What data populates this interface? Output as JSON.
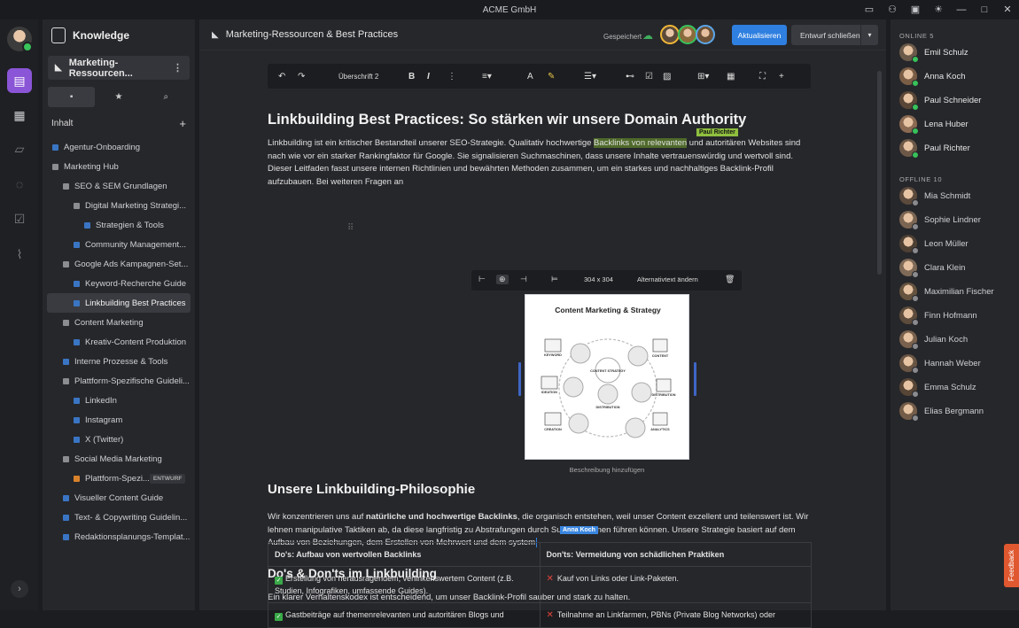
{
  "window": {
    "title": "ACME GmbH"
  },
  "sidebar": {
    "brand": "Knowledge",
    "current_page": "Marketing-Ressourcen...",
    "section_title": "Inhalt",
    "tree": [
      {
        "label": "Agentur-Onboarding",
        "level": 0,
        "color": "#3a75c4"
      },
      {
        "label": "Marketing Hub",
        "level": 0,
        "color": "#8c8d91"
      },
      {
        "label": "SEO & SEM Grundlagen",
        "level": 1,
        "color": "#8c8d91"
      },
      {
        "label": "Digital Marketing Strategi...",
        "level": 2,
        "color": "#8c8d91"
      },
      {
        "label": "Strategien & Tools",
        "level": 3,
        "color": "#3a75c4"
      },
      {
        "label": "Community Management...",
        "level": 2,
        "color": "#3a75c4"
      },
      {
        "label": "Google Ads Kampagnen-Set...",
        "level": 1,
        "color": "#8c8d91"
      },
      {
        "label": "Keyword-Recherche Guide",
        "level": 2,
        "color": "#3a75c4"
      },
      {
        "label": "Linkbuilding Best Practices",
        "level": 2,
        "color": "#3a75c4",
        "active": true
      },
      {
        "label": "Content Marketing",
        "level": 1,
        "color": "#8c8d91"
      },
      {
        "label": "Kreativ-Content Produktion",
        "level": 2,
        "color": "#3a75c4"
      },
      {
        "label": "Interne Prozesse & Tools",
        "level": 1,
        "color": "#3a75c4"
      },
      {
        "label": "Plattform-Spezifische Guideli...",
        "level": 1,
        "color": "#8c8d91"
      },
      {
        "label": "LinkedIn",
        "level": 2,
        "color": "#3a75c4"
      },
      {
        "label": "Instagram",
        "level": 2,
        "color": "#3a75c4"
      },
      {
        "label": "X (Twitter)",
        "level": 2,
        "color": "#3a75c4"
      },
      {
        "label": "Social Media Marketing",
        "level": 1,
        "color": "#8c8d91"
      },
      {
        "label": "Plattform-Spezi...",
        "level": 2,
        "color": "#d9822b",
        "badge": "ENTWURF"
      },
      {
        "label": "Visueller Content Guide",
        "level": 1,
        "color": "#3a75c4"
      },
      {
        "label": "Text- & Copywriting Guidelin...",
        "level": 1,
        "color": "#3a75c4"
      },
      {
        "label": "Redaktionsplanungs-Templat...",
        "level": 1,
        "color": "#3a75c4"
      }
    ]
  },
  "header": {
    "title": "Marketing-Ressourcen & Best Practices",
    "saved": "Gespeichert",
    "update_button": "Aktualisieren",
    "close_draft_button": "Entwurf schließen"
  },
  "toolbar": {
    "heading_style": "Überschrift 2"
  },
  "doc": {
    "h1": "Linkbuilding Best Practices: So stärken wir unsere Domain Authority",
    "p1_a": "Linkbuilding ist ein kritischer Bestandteil unserer SEO-Strategie. Qualitativ hochwertige ",
    "p1_hl": "Backlinks von relevanten",
    "p1_b": " und autoritären Websites sind nach wie vor ein starker Rankingfaktor für Google. Sie signalisieren Suchmaschinen, dass unsere Inhalte vertrauenswürdig und wertvoll sind. Dieser Leitfaden fasst unsere internen Richtlinien und bewährten Methoden zusammen, um ein starkes und nachhaltiges Backlink-Profil aufzubauen. Bei weiteren Fragen an",
    "cursor1": "Paul Richter",
    "image_size": "304 x 304",
    "alt_text_button": "Alternativtext ändern",
    "image_title": "Content Marketing & Strategy",
    "image_labels": [
      "KEYWORD",
      "CONTENT STRATEGY",
      "CONTENT",
      "IDEATION",
      "DISTRIBUTION",
      "DISTRIBUTION",
      "CREATION",
      "ANALYTICS"
    ],
    "caption": "Beschreibung hinzufügen",
    "h2": "Unsere Linkbuilding-Philosophie",
    "p2_a": "Wir konzentrieren uns auf ",
    "p2_bold": "natürliche und hochwertige Backlinks",
    "p2_b": ", die organisch entstehen, weil unser Content exzellent und teilenswert ist. Wir lehnen manipulative Taktiken ab, da diese langfristig zu Abstrafungen durch Suchmaschinen führen können. Unsere Strategie basiert auf dem Aufbau von Beziehungen, dem Erstellen von Mehrwert und dem system",
    "cursor2": "Anna Koch",
    "h3": "Do's & Don'ts im Linkbuilding",
    "p3": "Ein klarer Verhaltenskodex ist entscheidend, um unser Backlink-Profil sauber und stark zu halten.",
    "table": {
      "headers": [
        "Do's: Aufbau von wertvollen Backlinks",
        "Don'ts: Vermeidung von schädlichen Praktiken"
      ],
      "rows": [
        [
          "Erstellung von herausragendem, verlinkenswertem Content (z.B. Studien, Infografiken, umfassende Guides).",
          "Kauf von Links oder Link-Paketen."
        ],
        [
          "Gastbeiträge auf themenrelevanten und autoritären Blogs und",
          "Teilnahme an Linkfarmen, PBNs (Private Blog Networks) oder"
        ]
      ]
    }
  },
  "presence": {
    "online_label": "ONLINE 5",
    "offline_label": "OFFLINE 10",
    "online": [
      "Emil Schulz",
      "Anna Koch",
      "Paul Schneider",
      "Lena Huber",
      "Paul Richter"
    ],
    "offline": [
      "Mia Schmidt",
      "Sophie Lindner",
      "Leon Müller",
      "Clara Klein",
      "Maximilian Fischer",
      "Finn Hofmann",
      "Julian Koch",
      "Hannah Weber",
      "Emma Schulz",
      "Elias Bergmann"
    ]
  },
  "feedback": "Feedback"
}
